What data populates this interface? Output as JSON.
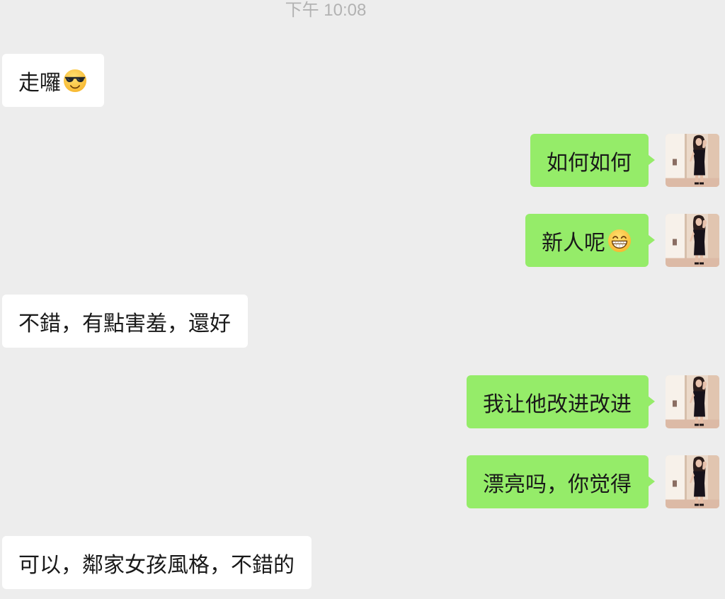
{
  "timestamp": "下午 10:08",
  "messages": [
    {
      "sent": false,
      "text": "走囉",
      "emoji": "smiling-face-with-sunglasses"
    },
    {
      "sent": true,
      "text": "如何如何"
    },
    {
      "sent": true,
      "text": "新人呢",
      "emoji": "grinning-face-with-smiling-eyes"
    },
    {
      "sent": false,
      "text": "不錯，有點害羞，還好"
    },
    {
      "sent": true,
      "text": "我让他改进改进"
    },
    {
      "sent": true,
      "text": "漂亮吗，你觉得"
    },
    {
      "sent": false,
      "text": "可以，鄰家女孩風格，不錯的"
    }
  ],
  "colors": {
    "background": "#ededed",
    "sent_bubble": "#95ec69",
    "received_bubble": "#ffffff",
    "message_text": "#191919",
    "timestamp_text": "#b2b2b2"
  }
}
